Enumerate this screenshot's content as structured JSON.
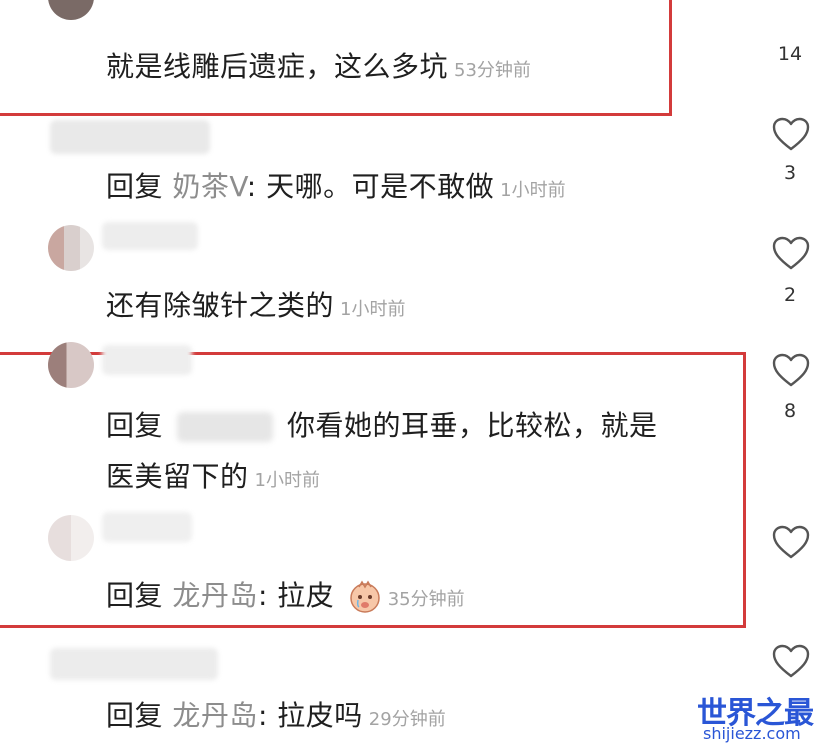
{
  "comments": [
    {
      "text": "就是线雕后遗症，这么多坑",
      "time": "53分钟前"
    },
    {
      "prefix": "回复",
      "name": "奶茶V",
      "sep": ":",
      "text": "天哪。可是不敢做",
      "time": "1小时前"
    },
    {
      "text": "还有除皱针之类的",
      "time": "1小时前"
    },
    {
      "prefix": "回复",
      "line1": "你看她的耳垂，比较松，就是",
      "line2": "医美留下的",
      "time": "1小时前"
    },
    {
      "prefix": "回复",
      "name": "龙丹岛",
      "sep": ":",
      "text": "拉皮",
      "time": "35分钟前"
    },
    {
      "prefix": "回复",
      "name": "龙丹岛",
      "sep": ":",
      "text": "拉皮吗",
      "time": "29分钟前"
    }
  ],
  "likes": [
    "14",
    "3",
    "2",
    "8"
  ],
  "icons": {
    "like": "heart-outline-icon",
    "emoji": "crying-face-emoji-icon"
  },
  "colors": {
    "highlight": "#d33b3b",
    "watermark": "#2a56d6"
  },
  "watermark": {
    "title": "世界之最",
    "url": "shijiezz.com"
  }
}
